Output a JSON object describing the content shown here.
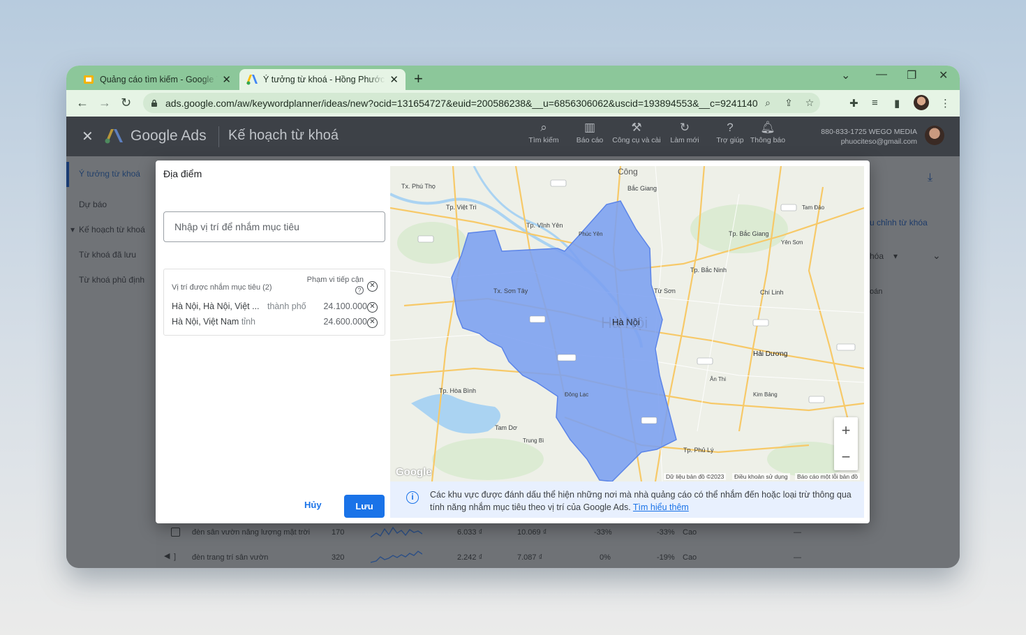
{
  "browser": {
    "tabs": [
      {
        "title": "Quảng cáo tìm kiếm - Google Tr",
        "active": false
      },
      {
        "title": "Ý tưởng từ khoá - Hồng Phước A",
        "active": true
      }
    ],
    "url": "ads.google.com/aw/keywordplanner/ideas/new?ocid=131654727&euid=200586238&__u=6856306062&uscid=193894553&__c=9241140..."
  },
  "app": {
    "brand": "Google Ads",
    "page_title": "Kế hoạch từ khoá",
    "header_buttons": [
      {
        "label": "Tìm kiếm",
        "icon": "search-icon"
      },
      {
        "label": "Báo cáo",
        "icon": "report-icon"
      },
      {
        "label": "Công cụ và cài",
        "icon": "wrench-icon"
      },
      {
        "label": "Làm mới",
        "icon": "refresh-icon"
      },
      {
        "label": "Trợ giúp",
        "icon": "help-icon"
      },
      {
        "label": "Thông báo",
        "icon": "bell-icon"
      }
    ],
    "account_line1": "880-833-1725 WEGO MEDIA",
    "account_line2": "phuociteso@gmail.com"
  },
  "sidebar": {
    "items": [
      {
        "label": "Ý tưởng từ khoá"
      },
      {
        "label": "Dự báo"
      },
      {
        "label": "Kế hoạch từ khoá"
      },
      {
        "label": "Từ khoá đã lưu"
      },
      {
        "label": "Từ khoá phủ định"
      }
    ]
  },
  "background": {
    "right_link": "u chỉnh từ khóa",
    "right_filter": "hóa",
    "right_text": "oán",
    "rows": [
      {
        "keyword": "đèn sân vườn năng lượng mặt trời",
        "volume": "170",
        "bid_low": "6.033 ₫",
        "bid_high": "10.069 ₫",
        "change3m": "-33%",
        "yoy": "-33%",
        "competition": "Cao",
        "extra": "—"
      },
      {
        "keyword": "đèn trang trí sân vườn",
        "volume": "320",
        "bid_low": "2.242 ₫",
        "bid_high": "7.087 ₫",
        "change3m": "0%",
        "yoy": "-19%",
        "competition": "Cao",
        "extra": "—"
      }
    ]
  },
  "modal": {
    "title": "Địa điểm",
    "search_placeholder": "Nhập vị trí để nhắm mục tiêu",
    "list_header": "Vị trí được nhắm mục tiêu (2)",
    "reach_header": "Phạm vi tiếp cận",
    "locations": [
      {
        "name": "Hà Nội, Hà Nội, Việt ...",
        "type": "thành phố",
        "reach": "24.100.000"
      },
      {
        "name": "Hà Nội, Việt Nam",
        "type": "tỉnh",
        "reach": "24.600.000"
      }
    ],
    "cancel_label": "Hủy",
    "save_label": "Lưu",
    "info_text": "Các khu vực được đánh dấu thể hiện những nơi mà nhà quảng cáo có thể nhắm đến hoặc loại trừ thông qua tính năng nhắm mục tiêu theo vị trí của Google Ads.",
    "info_link": "Tìm hiểu thêm"
  },
  "map": {
    "labels": {
      "hanoi": "Hà Nội",
      "hanoi_big": "Hà Nội",
      "haiduong": "Hải Dương",
      "tpvinhyen": "Tp. Vĩnh Yên",
      "tpbacninh": "Tp. Bắc Ninh",
      "tpbacgiang": "Tp. Bắc Giang",
      "tpviettri": "Tp. Việt Trì",
      "tpsonla": "Tp. Hòa Bình",
      "tpphuly": "Tp. Phủ Lý",
      "tpsontay": "Tx. Sơn Tây",
      "tpuongbi": "Chí Linh",
      "phucyen": "Phúc Yên",
      "tpthaibinh": "Tam Đảo",
      "dongluc": "Đông Lạc",
      "trungbi": "Trung Bì",
      "congl": "Công",
      "bangiang": "Bắc Giang",
      "tpsonla2": "Tx. Phú Thọ",
      "tuson": "Từ Sơn",
      "anlao": "Ân Thi",
      "yenson": "Yên Sơn",
      "tamdao": "Tam Dơ",
      "kimbang": "Kim Bảng"
    },
    "attribution": "Dữ liệu bản đồ ©2023",
    "terms": "Điều khoản sử dụng",
    "report": "Báo cáo một lỗi bản đồ",
    "google": "Google",
    "zoom_in": "+",
    "zoom_out": "−"
  },
  "colors": {
    "primary": "#1a73e8",
    "polygon_fill": "#7b9ff0",
    "polygon_stroke": "#5b84e8",
    "tab_green": "#8cc79a"
  }
}
